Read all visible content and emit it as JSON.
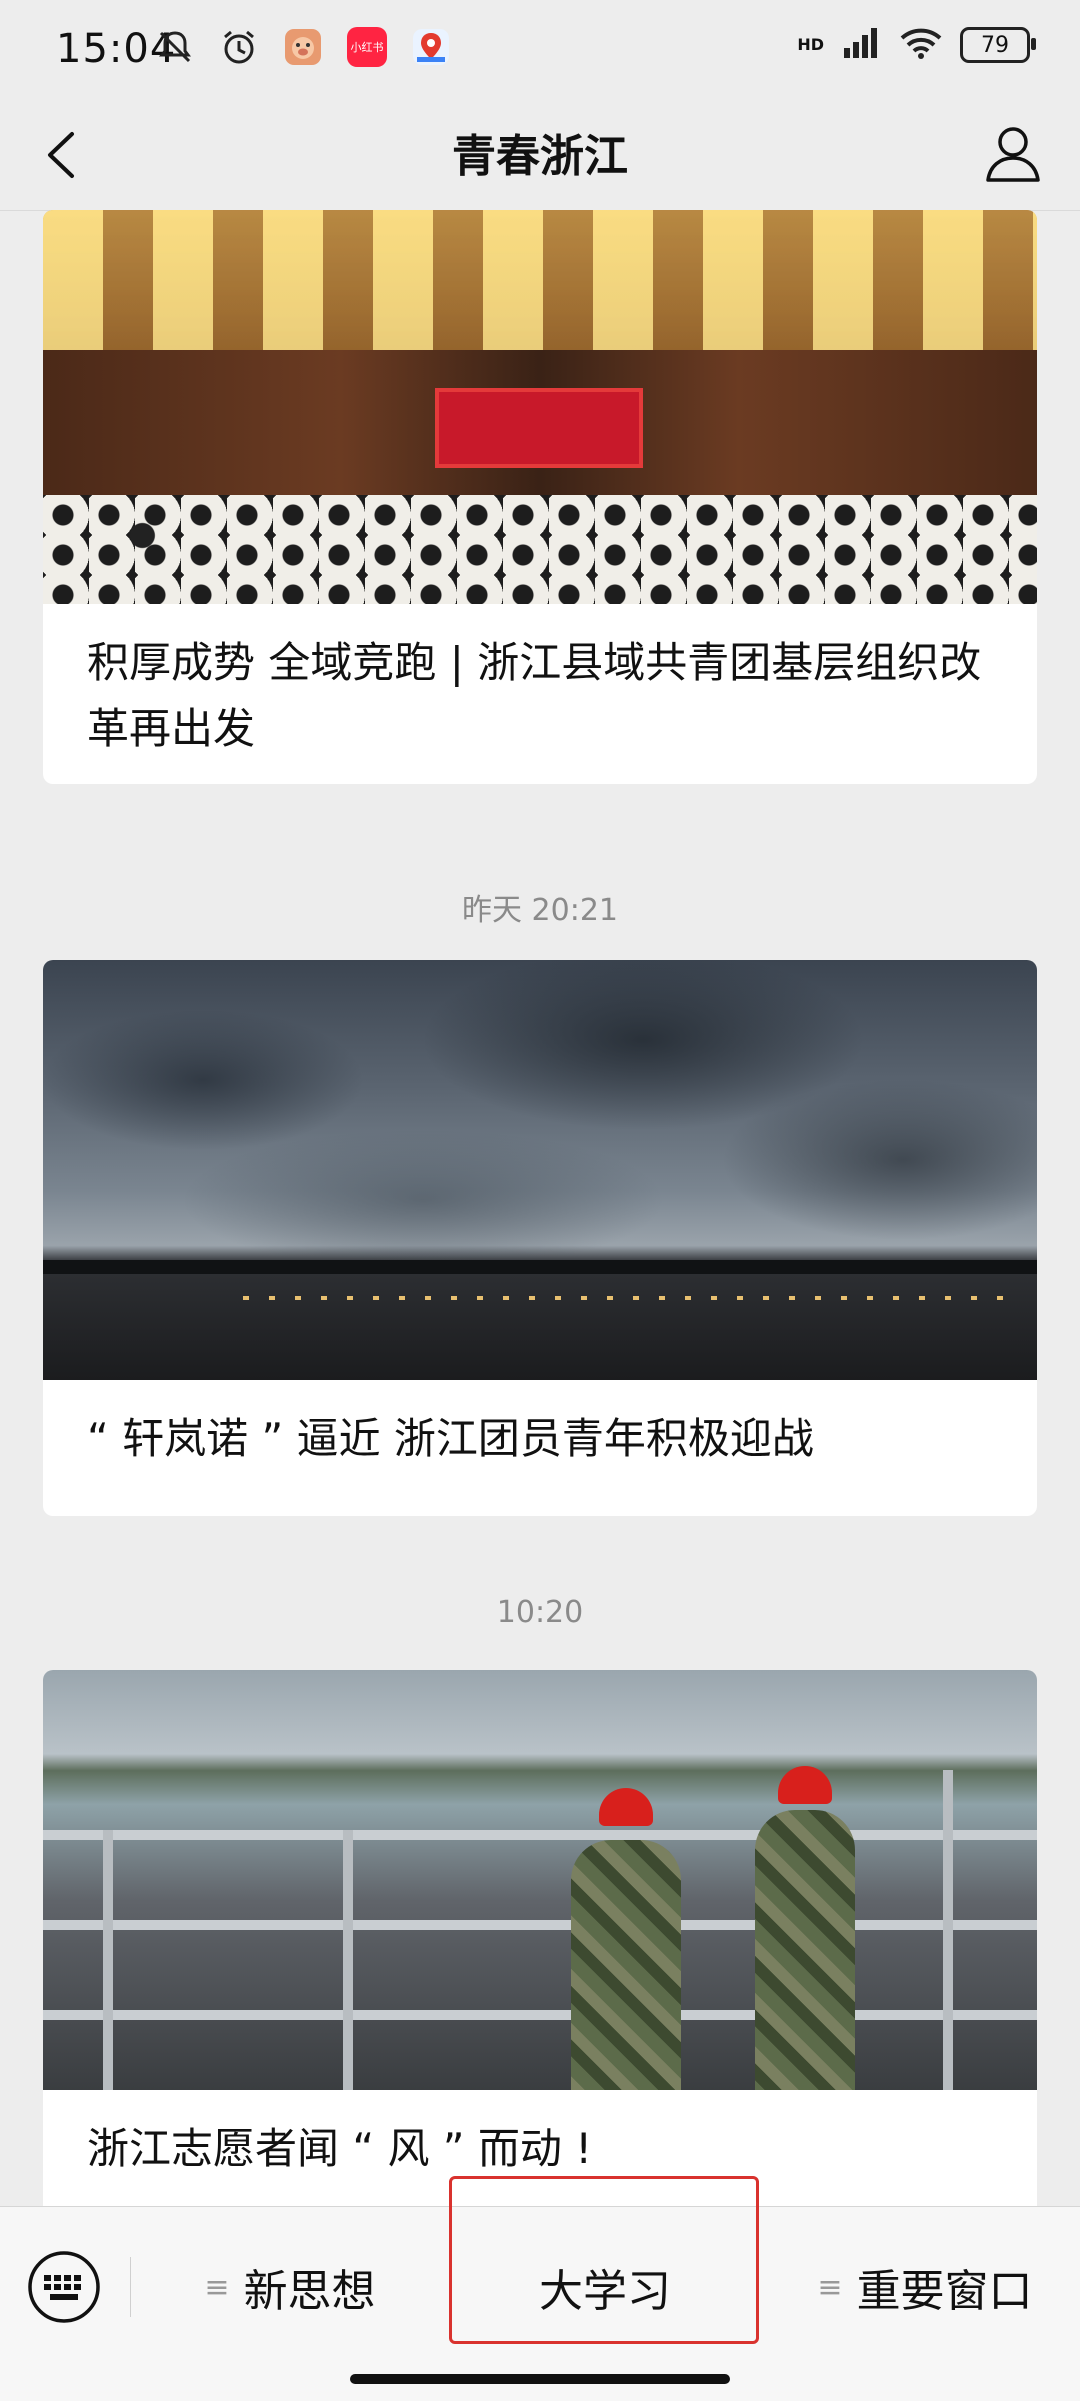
{
  "status_bar": {
    "time": "15:04",
    "battery": "79",
    "network": "HD",
    "app_badge_text": "小红书"
  },
  "nav": {
    "title": "青春浙江"
  },
  "feed": {
    "articles": [
      {
        "title": "积厚成势 全域竞跑 | 浙江县域共青团基层组织改革再出发"
      },
      {
        "title": "“ 轩岚诺 ” 逼近 浙江团员青年积极迎战"
      },
      {
        "title": "浙江志愿者闻 “ 风 ” 而动 !"
      }
    ],
    "timestamps": [
      "昨天 20:21",
      "10:20"
    ]
  },
  "menu": {
    "items": [
      {
        "label": "新思想"
      },
      {
        "label": "大学习"
      },
      {
        "label": "重要窗口"
      }
    ]
  },
  "colors": {
    "highlight": "#d9322e",
    "background": "#ededed"
  }
}
